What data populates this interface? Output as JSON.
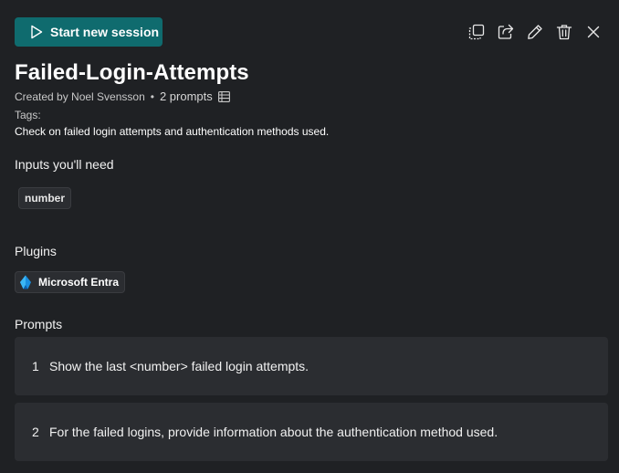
{
  "toolbar": {
    "start_label": "Start new session",
    "icons": [
      "duplicate-icon",
      "share-icon",
      "edit-icon",
      "delete-icon",
      "close-icon"
    ]
  },
  "header": {
    "title": "Failed-Login-Attempts",
    "created_by": "Created by Noel Svensson",
    "separator": "•",
    "prompt_count": "2 prompts",
    "tags_label": "Tags:",
    "description": "Check on failed login attempts and authentication methods used."
  },
  "inputs": {
    "heading": "Inputs you'll need",
    "items": [
      "number"
    ]
  },
  "plugins": {
    "heading": "Plugins",
    "items": [
      "Microsoft Entra"
    ]
  },
  "prompts": {
    "heading": "Prompts",
    "items": [
      {
        "number": "1",
        "text": "Show the last <number> failed login attempts."
      },
      {
        "number": "2",
        "text": "For the failed logins, provide information about the authentication method used."
      }
    ]
  },
  "colors": {
    "background": "#1f2124",
    "accent": "#0f6b6e",
    "card": "#2b2d31"
  }
}
